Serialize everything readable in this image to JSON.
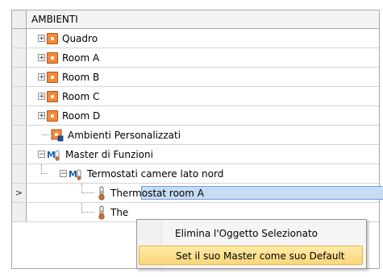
{
  "grid": {
    "header": "AMBIENTI"
  },
  "tree": {
    "quadro": "Quadro",
    "room_a": "Room A",
    "room_b": "Room B",
    "room_c": "Room C",
    "room_d": "Room D",
    "ambienti_personalizzati": "Ambienti Personalizzati",
    "master_di_funzioni": "Master di Funzioni",
    "termostati": "Termostati camere lato nord",
    "thermostat_room_a": "Thermostat room A",
    "thermostat_partial": "The"
  },
  "row_indicator": ">",
  "context_menu": {
    "items": [
      "Elimina l'Oggetto Selezionato",
      "Set il suo Master come suo Default"
    ]
  },
  "colors": {
    "accent_orange": "#f08a3a",
    "selection": "#c6dcf4",
    "menu_highlight": "#fbd67a"
  },
  "icons": {
    "expand": "plus-box-icon",
    "collapse": "minus-box-icon",
    "room": "orange-room-icon",
    "thermostat": "thermometer-icon",
    "master": "master-function-icon",
    "custom": "custom-room-icon"
  }
}
